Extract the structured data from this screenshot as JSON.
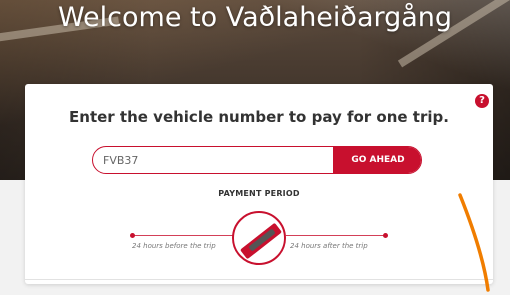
{
  "hero": {
    "title": "Welcome to Vaðlaheiðargång"
  },
  "card": {
    "heading": "Enter the vehicle number to pay for one trip.",
    "help_icon": "question-circle-icon",
    "help_glyph": "?",
    "vehicle_input_value": "FVB37",
    "submit_label": "GO AHEAD",
    "payment_period_label": "PAYMENT PERIOD",
    "before_label": "24 hours before the trip",
    "after_label": "24 hours after the trip",
    "center_icon": "ticket-icon"
  },
  "colors": {
    "accent": "#c8102e",
    "annotation": "#f07d00"
  }
}
